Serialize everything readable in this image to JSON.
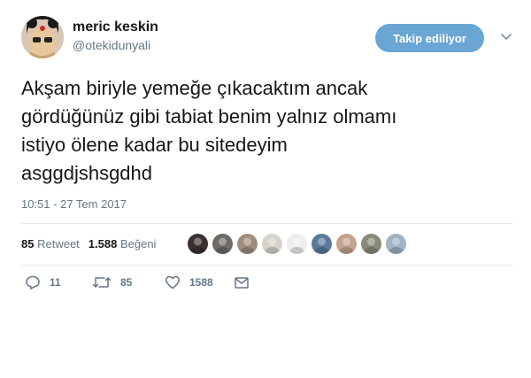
{
  "user": {
    "display_name": "meric keskin",
    "handle": "@otekidunyali"
  },
  "follow_button": {
    "label": "Takip ediliyor",
    "color": "#69a6d4"
  },
  "tweet": {
    "text": "Akşam biriyle yemeğe çıkacaktım ancak\ngördüğünüz gibi tabiat benim yalnız olmamı\nistiyo ölene kadar bu sitedeyim\nasggdjshsgdhd",
    "timestamp": "10:51 - 27 Tem 2017"
  },
  "stats": {
    "retweets_count": "85",
    "retweets_label": "Retweet",
    "likes_count": "1.588",
    "likes_label": "Beğeni"
  },
  "likers": [
    {
      "color": "#3a3030"
    },
    {
      "color": "#6f6a66"
    },
    {
      "color": "#a08c7a"
    },
    {
      "color": "#d8d2cc"
    },
    {
      "color": "#eeeeee"
    },
    {
      "color": "#5a7a9a"
    },
    {
      "color": "#c4a48e"
    },
    {
      "color": "#8a8a7a"
    },
    {
      "color": "#9fb3c3"
    }
  ],
  "actions": {
    "reply_count": "11",
    "retweet_count": "85",
    "like_count": "1588"
  },
  "colors": {
    "text": "#14171a",
    "secondary": "#657786",
    "divider": "#e6ecf0"
  }
}
